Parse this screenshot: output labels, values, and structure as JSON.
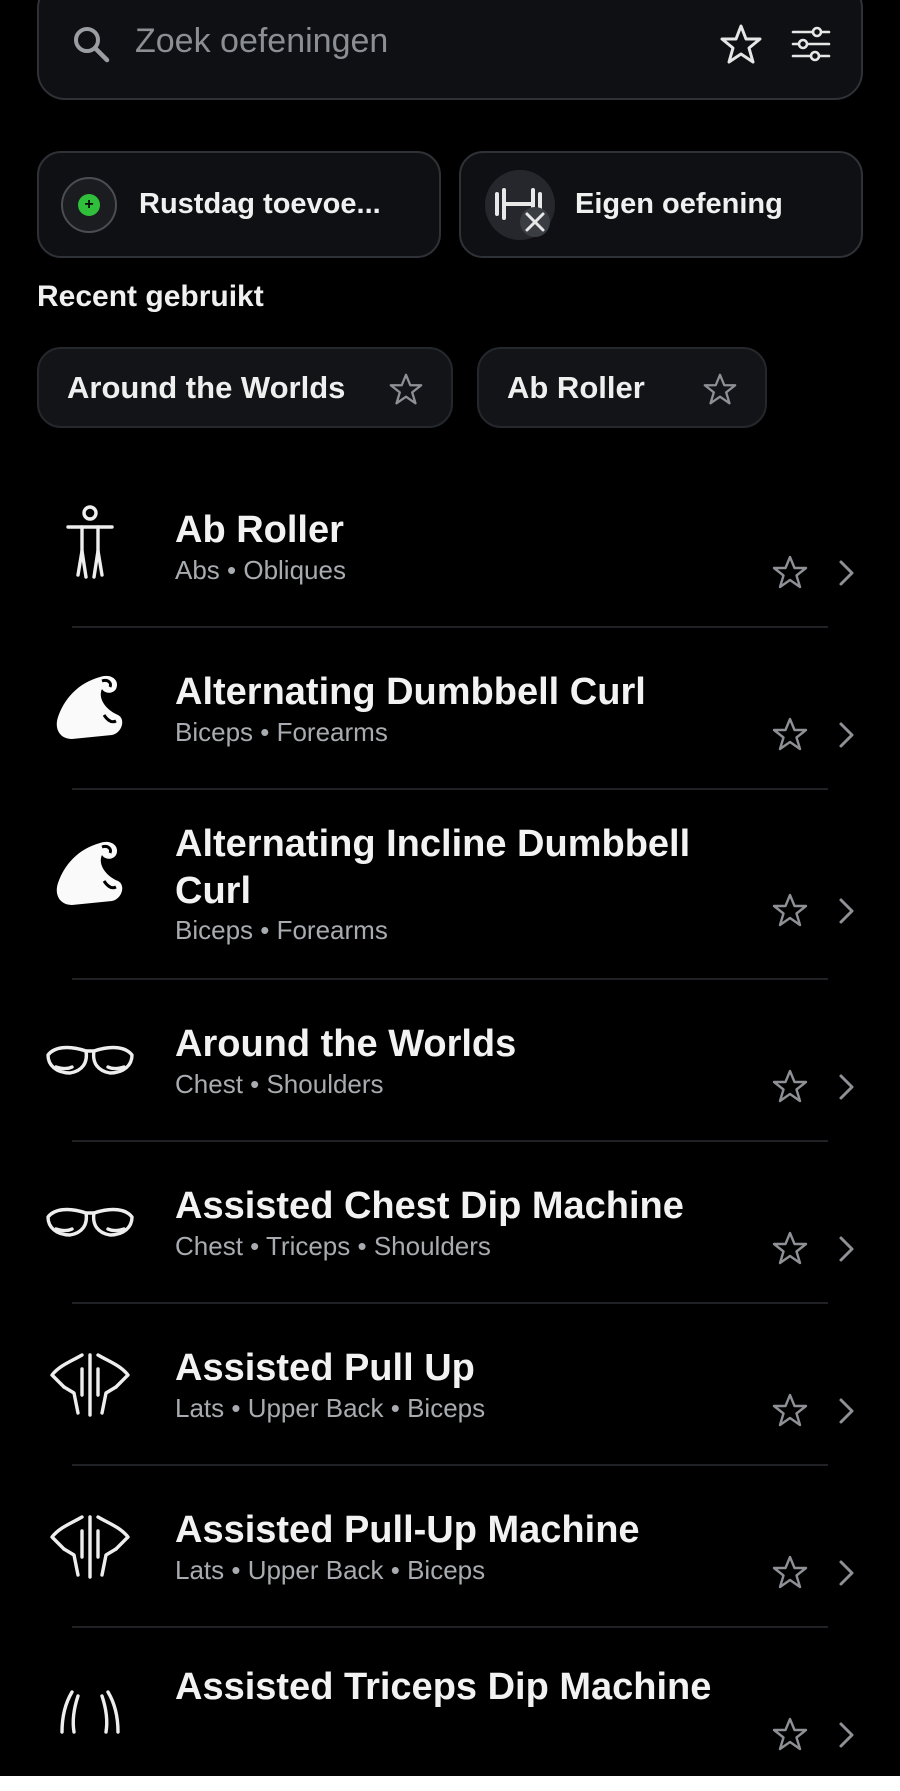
{
  "search": {
    "placeholder": "Zoek oefeningen"
  },
  "actions": {
    "rest_day": "Rustdag toevoe...",
    "custom_exercise": "Eigen oefening"
  },
  "recent": {
    "title": "Recent gebruikt",
    "chips": [
      "Around the Worlds",
      "Ab Roller"
    ]
  },
  "exercises": [
    {
      "name": "Ab Roller",
      "muscles": "Abs • Obliques",
      "icon": "body-figure-icon"
    },
    {
      "name": "Alternating Dumbbell Curl",
      "muscles": "Biceps • Forearms",
      "icon": "bicep-icon"
    },
    {
      "name": "Alternating Incline Dumbbell Curl",
      "muscles": "Biceps • Forearms",
      "icon": "bicep-icon"
    },
    {
      "name": "Around the Worlds",
      "muscles": "Chest • Shoulders",
      "icon": "chest-icon"
    },
    {
      "name": "Assisted Chest Dip Machine",
      "muscles": "Chest • Triceps • Shoulders",
      "icon": "chest-icon"
    },
    {
      "name": "Assisted Pull Up",
      "muscles": "Lats • Upper Back • Biceps",
      "icon": "back-icon"
    },
    {
      "name": "Assisted Pull-Up Machine",
      "muscles": "Lats • Upper Back • Biceps",
      "icon": "back-icon"
    },
    {
      "name": "Assisted Triceps Dip Machine",
      "muscles": "",
      "icon": "triceps-icon"
    }
  ],
  "colors": {
    "background": "#000000",
    "card": "#0e1013",
    "border": "#2e3136",
    "accent_green": "#2fbf3a"
  }
}
